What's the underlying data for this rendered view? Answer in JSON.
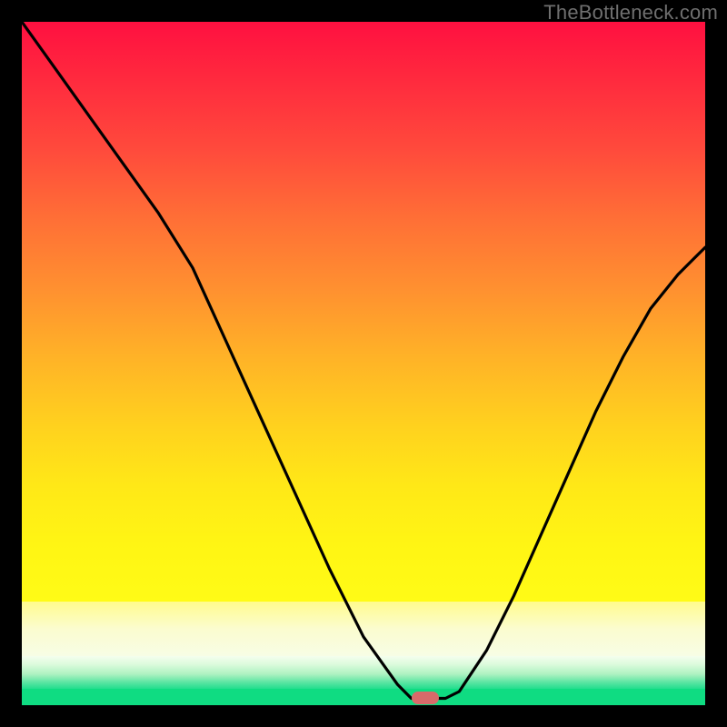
{
  "watermark": {
    "text": "TheBottleneck.com"
  },
  "chart_data": {
    "type": "line",
    "title": "",
    "xlabel": "",
    "ylabel": "",
    "xlim": [
      0,
      100
    ],
    "ylim": [
      0,
      100
    ],
    "grid": false,
    "legend": false,
    "series": [
      {
        "name": "bottleneck-curve",
        "x": [
          0,
          5,
          10,
          15,
          20,
          25,
          30,
          35,
          40,
          45,
          50,
          55,
          57,
          60,
          62,
          64,
          68,
          72,
          76,
          80,
          84,
          88,
          92,
          96,
          100
        ],
        "y": [
          100,
          93,
          86,
          79,
          72,
          64,
          53,
          42,
          31,
          20,
          10,
          3,
          1,
          1,
          1,
          2,
          8,
          16,
          25,
          34,
          43,
          51,
          58,
          63,
          67
        ]
      }
    ],
    "marker": {
      "x": 59,
      "y": 1,
      "shape": "pill",
      "color": "#d86a6a"
    },
    "background_gradient": {
      "stops": [
        {
          "pos": 0.0,
          "color": "#ff1040"
        },
        {
          "pos": 0.5,
          "color": "#ffb327"
        },
        {
          "pos": 0.8,
          "color": "#fff514"
        },
        {
          "pos": 0.9,
          "color": "#fbfccf"
        },
        {
          "pos": 0.97,
          "color": "#62e6a5"
        },
        {
          "pos": 1.0,
          "color": "#0fdc82"
        }
      ]
    }
  }
}
